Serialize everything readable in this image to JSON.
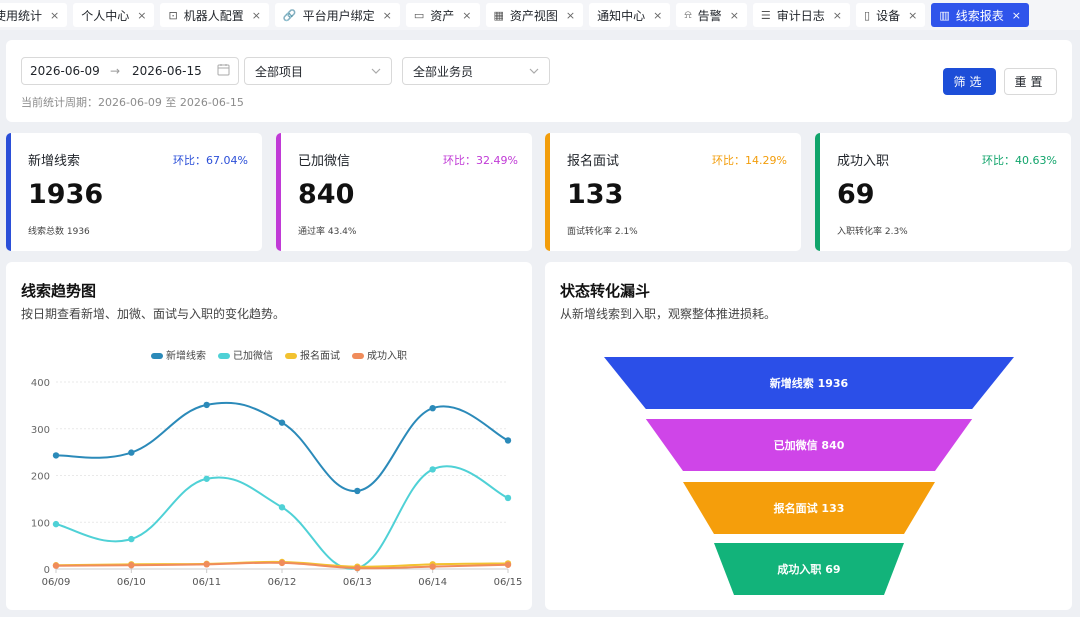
{
  "tabs": [
    {
      "label": "使用统计",
      "icon": "",
      "active": false
    },
    {
      "label": "个人中心",
      "icon": "",
      "active": false
    },
    {
      "label": "机器人配置",
      "icon": "robot-icon",
      "active": false
    },
    {
      "label": "平台用户绑定",
      "icon": "link-icon",
      "active": false
    },
    {
      "label": "资产",
      "icon": "monitor-icon",
      "active": false
    },
    {
      "label": "资产视图",
      "icon": "grid-icon",
      "active": false
    },
    {
      "label": "通知中心",
      "icon": "",
      "active": false
    },
    {
      "label": "告警",
      "icon": "alarm-icon",
      "active": false
    },
    {
      "label": "审计日志",
      "icon": "list-icon",
      "active": false
    },
    {
      "label": "设备",
      "icon": "phone-icon",
      "active": false
    },
    {
      "label": "线索报表",
      "icon": "chart-icon",
      "active": true
    }
  ],
  "filter": {
    "start_date": "2026-06-09",
    "end_date": "2026-06-15",
    "project": "全部项目",
    "salesperson": "全部业务员",
    "period_text": "当前统计周期：2026-06-09 至 2026-06-15",
    "filter_button": "筛选",
    "reset_button": "重置"
  },
  "kpis": [
    {
      "label": "新增线索",
      "ratio": "环比：67.04%",
      "value": "1936",
      "sub": "线索总数 1936",
      "color": "#2b4fd8"
    },
    {
      "label": "已加微信",
      "ratio": "环比：32.49%",
      "value": "840",
      "sub": "通过率 43.4%",
      "color": "#c03ad6"
    },
    {
      "label": "报名面试",
      "ratio": "环比：14.29%",
      "value": "133",
      "sub": "面试转化率 2.1%",
      "color": "#f29d0b"
    },
    {
      "label": "成功入职",
      "ratio": "环比：40.63%",
      "value": "69",
      "sub": "入职转化率 2.3%",
      "color": "#11a46b"
    }
  ],
  "trend": {
    "title": "线索趋势图",
    "subtitle": "按日期查看新增、加微、面试与入职的变化趋势。"
  },
  "funnel_card": {
    "title": "状态转化漏斗",
    "subtitle": "从新增线索到入职，观察整体推进损耗。"
  },
  "chart_data": [
    {
      "type": "line",
      "title": "线索趋势图",
      "x": [
        "06/09",
        "06/10",
        "06/11",
        "06/12",
        "06/13",
        "06/14",
        "06/15"
      ],
      "ylim": [
        0,
        400
      ],
      "yticks": [
        0,
        100,
        200,
        300,
        400
      ],
      "grid": true,
      "smooth": true,
      "legend_position": "top",
      "series": [
        {
          "name": "新增线索",
          "color": "#2b8ab9",
          "values": [
            243,
            249,
            351,
            313,
            167,
            344,
            275
          ]
        },
        {
          "name": "已加微信",
          "color": "#4fd1d6",
          "values": [
            96,
            64,
            193,
            132,
            2,
            213,
            152
          ]
        },
        {
          "name": "报名面试",
          "color": "#f2c230",
          "values": [
            8,
            10,
            11,
            15,
            5,
            10,
            12
          ]
        },
        {
          "name": "成功入职",
          "color": "#f08c5b",
          "values": [
            7,
            8,
            10,
            13,
            2,
            5,
            9
          ]
        }
      ]
    },
    {
      "type": "funnel",
      "title": "状态转化漏斗",
      "stages": [
        {
          "name": "新增线索",
          "value": 1936,
          "color": "#2b4fe8"
        },
        {
          "name": "已加微信",
          "value": 840,
          "color": "#cf45e8"
        },
        {
          "name": "报名面试",
          "value": 133,
          "color": "#f59e0b"
        },
        {
          "name": "成功入职",
          "value": 69,
          "color": "#12b37a"
        }
      ]
    }
  ]
}
